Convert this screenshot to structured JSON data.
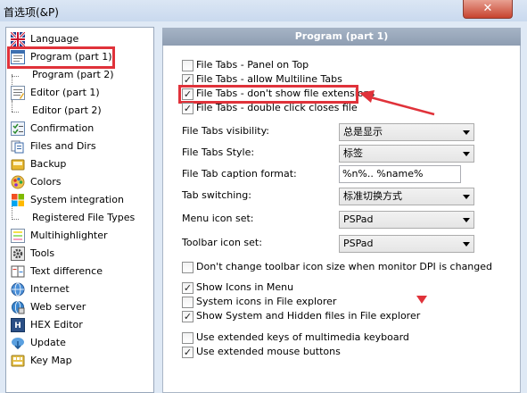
{
  "window": {
    "title": "首选项(&P)",
    "close_glyph": "✕"
  },
  "sidebar": {
    "items": [
      {
        "label": "Language",
        "icon": "flag-icon"
      },
      {
        "label": "Program  (part 1)",
        "icon": "window-icon"
      },
      {
        "label": "Program  (part 2)",
        "icon": ""
      },
      {
        "label": "Editor  (part 1)",
        "icon": "editor-icon"
      },
      {
        "label": "Editor  (part 2)",
        "icon": ""
      },
      {
        "label": "Confirmation",
        "icon": "checklist-icon"
      },
      {
        "label": "Files and Dirs",
        "icon": "files-icon"
      },
      {
        "label": "Backup",
        "icon": "backup-icon"
      },
      {
        "label": "Colors",
        "icon": "palette-icon"
      },
      {
        "label": "System integration",
        "icon": "windows-logo-icon"
      },
      {
        "label": "Registered File Types",
        "icon": ""
      },
      {
        "label": "Multihighlighter",
        "icon": "highlighter-icon"
      },
      {
        "label": "Tools",
        "icon": "gear-icon"
      },
      {
        "label": "Text difference",
        "icon": "diff-icon"
      },
      {
        "label": "Internet",
        "icon": "globe-icon"
      },
      {
        "label": "Web server",
        "icon": "server-icon"
      },
      {
        "label": "HEX Editor",
        "icon": "hex-icon"
      },
      {
        "label": "Update",
        "icon": "update-icon"
      },
      {
        "label": "Key Map",
        "icon": "keyboard-icon"
      }
    ]
  },
  "main": {
    "header": "Program  (part 1)",
    "checkboxes_top": [
      {
        "label": "File Tabs - Panel on Top",
        "checked": false
      },
      {
        "label": "File Tabs - allow Multiline Tabs",
        "checked": true
      },
      {
        "label": "File Tabs - don't show file extensions",
        "checked": true
      },
      {
        "label": "File Tabs - double click closes file",
        "checked": true
      }
    ],
    "fields": [
      {
        "label": "File Tabs visibility:",
        "value": "总是显示",
        "kind": "select"
      },
      {
        "label": "File Tabs Style:",
        "value": "标签",
        "kind": "select"
      },
      {
        "label": "File Tab caption format:",
        "value": "%n%.. %name%",
        "kind": "text"
      },
      {
        "label": "Tab switching:",
        "value": "标准切换方式",
        "kind": "select"
      },
      {
        "label": "Menu icon set:",
        "value": "PSPad",
        "kind": "select"
      },
      {
        "label": "Toolbar icon set:",
        "value": "PSPad",
        "kind": "select"
      }
    ],
    "checkboxes_bottom": [
      {
        "label": "Don't change toolbar icon size when monitor DPI is changed",
        "checked": false
      },
      {
        "label": "Show Icons in Menu",
        "checked": true
      },
      {
        "label": "System icons in File explorer",
        "checked": false
      },
      {
        "label": "Show System and Hidden files in File explorer",
        "checked": true
      },
      {
        "label": "Use extended keys of multimedia keyboard",
        "checked": false
      },
      {
        "label": "Use extended mouse buttons",
        "checked": true
      }
    ]
  },
  "colors": {
    "annotation_red": "#e0323a",
    "header_bg": "#94a3b8"
  }
}
